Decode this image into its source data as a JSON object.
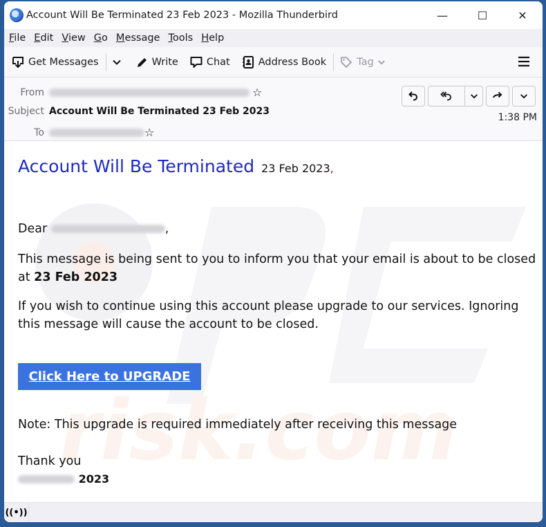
{
  "window": {
    "title": "Account Will Be Terminated 23 Feb 2023 - Mozilla Thunderbird",
    "controls": {
      "minimize": "—",
      "maximize": "☐",
      "close": "✕"
    }
  },
  "menu": [
    {
      "key": "F",
      "rest": "ile"
    },
    {
      "key": "E",
      "rest": "dit"
    },
    {
      "key": "V",
      "rest": "iew"
    },
    {
      "key": "G",
      "rest": "o"
    },
    {
      "key": "M",
      "rest": "essage"
    },
    {
      "key": "T",
      "rest": "ools"
    },
    {
      "key": "H",
      "rest": "elp"
    }
  ],
  "toolbar": {
    "get_messages": "Get Messages",
    "write": "Write",
    "chat": "Chat",
    "address_book": "Address Book",
    "tag": "Tag"
  },
  "header": {
    "from_label": "From",
    "subject_label": "Subject",
    "subject": "Account Will Be Terminated 23 Feb 2023",
    "to_label": "To",
    "time": "1:38 PM"
  },
  "body": {
    "heading": "Account Will Be Terminated",
    "heading_date": "23 Feb 2023",
    "heading_comma": ",",
    "greeting": "Dear",
    "greeting_comma": ",",
    "p1": "This message is being sent to you to inform you that your email is about to be closed",
    "p1_at": "at",
    "p1_date": "23 Feb 2023",
    "p2": "If you wish to continue using this account  please upgrade to our services. Ignoring this message will cause the account to be closed.",
    "button": "Click Here to UPGRADE",
    "note": "Note: This upgrade is required immediately after receiving this message",
    "thanks": "Thank you",
    "sign_year": "2023"
  },
  "colors": {
    "heading": "#1c2ac0",
    "button": "#3a73e0",
    "desktop": "#2a5b98"
  }
}
